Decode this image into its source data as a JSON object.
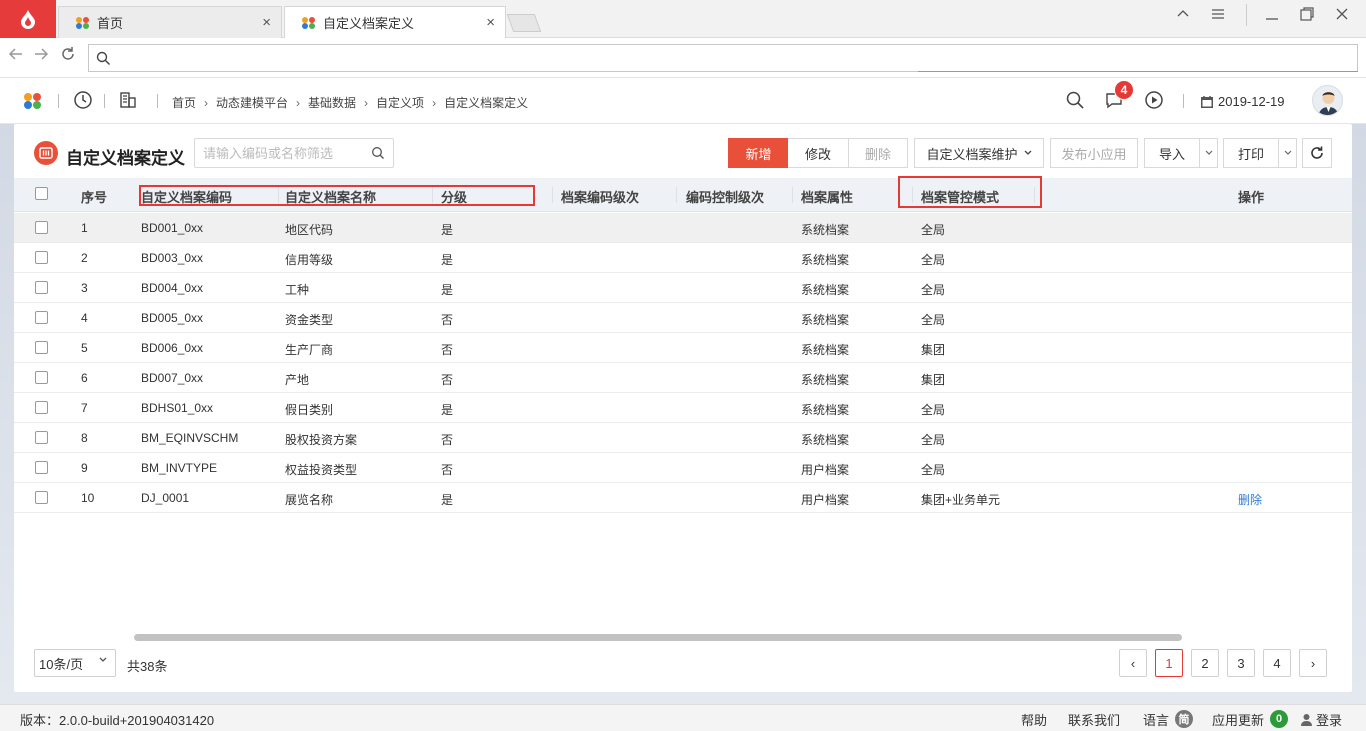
{
  "browser": {
    "tabs": [
      {
        "label": "首页"
      },
      {
        "label": "自定义档案定义"
      }
    ],
    "close_glyph": "×"
  },
  "header": {
    "breadcrumb": [
      "首页",
      "动态建模平台",
      "基础数据",
      "自定义项",
      "自定义档案定义"
    ],
    "notification_count": "4",
    "date": "2019-12-19"
  },
  "panel": {
    "title": "自定义档案定义",
    "search_placeholder": "请输入编码或名称筛选",
    "toolbar": {
      "add": "新增",
      "edit": "修改",
      "delete": "删除",
      "maintain": "自定义档案维护",
      "publish": "发布小应用",
      "import": "导入",
      "print": "打印"
    }
  },
  "table": {
    "columns": {
      "seq": "序号",
      "code": "自定义档案编码",
      "name": "自定义档案名称",
      "level": "分级",
      "code_level": "档案编码级次",
      "ctrl_level": "编码控制级次",
      "attr": "档案属性",
      "mode": "档案管控模式",
      "ops": "操作"
    },
    "rows": [
      {
        "seq": "1",
        "code": "BD001_0xx",
        "name": "地区代码",
        "level": "是",
        "attr": "系统档案",
        "mode": "全局",
        "op": ""
      },
      {
        "seq": "2",
        "code": "BD003_0xx",
        "name": "信用等级",
        "level": "是",
        "attr": "系统档案",
        "mode": "全局",
        "op": ""
      },
      {
        "seq": "3",
        "code": "BD004_0xx",
        "name": "工种",
        "level": "是",
        "attr": "系统档案",
        "mode": "全局",
        "op": ""
      },
      {
        "seq": "4",
        "code": "BD005_0xx",
        "name": "资金类型",
        "level": "否",
        "attr": "系统档案",
        "mode": "全局",
        "op": ""
      },
      {
        "seq": "5",
        "code": "BD006_0xx",
        "name": "生产厂商",
        "level": "否",
        "attr": "系统档案",
        "mode": "集团",
        "op": ""
      },
      {
        "seq": "6",
        "code": "BD007_0xx",
        "name": "产地",
        "level": "否",
        "attr": "系统档案",
        "mode": "集团",
        "op": ""
      },
      {
        "seq": "7",
        "code": "BDHS01_0xx",
        "name": "假日类别",
        "level": "是",
        "attr": "系统档案",
        "mode": "全局",
        "op": ""
      },
      {
        "seq": "8",
        "code": "BM_EQINVSCHM",
        "name": "股权投资方案",
        "level": "否",
        "attr": "系统档案",
        "mode": "全局",
        "op": ""
      },
      {
        "seq": "9",
        "code": "BM_INVTYPE",
        "name": "权益投资类型",
        "level": "否",
        "attr": "用户档案",
        "mode": "全局",
        "op": ""
      },
      {
        "seq": "10",
        "code": "DJ_0001",
        "name": "展览名称",
        "level": "是",
        "attr": "用户档案",
        "mode": "集团+业务单元",
        "op": "删除"
      }
    ]
  },
  "pagination": {
    "page_size": "10条/页",
    "total": "共38条",
    "prev": "‹",
    "next": "›",
    "pages": [
      "1",
      "2",
      "3",
      "4"
    ],
    "current": "1"
  },
  "footer": {
    "version": "版本：2.0.0-build+201904031420",
    "help": "帮助",
    "contact": "联系我们",
    "language": "语言",
    "language_badge": "简",
    "updates": "应用更新",
    "updates_count": "0",
    "login": "登录"
  },
  "colors": {
    "brand": "#e8503a",
    "highlight": "#e53935",
    "link": "#2f7bd3"
  }
}
